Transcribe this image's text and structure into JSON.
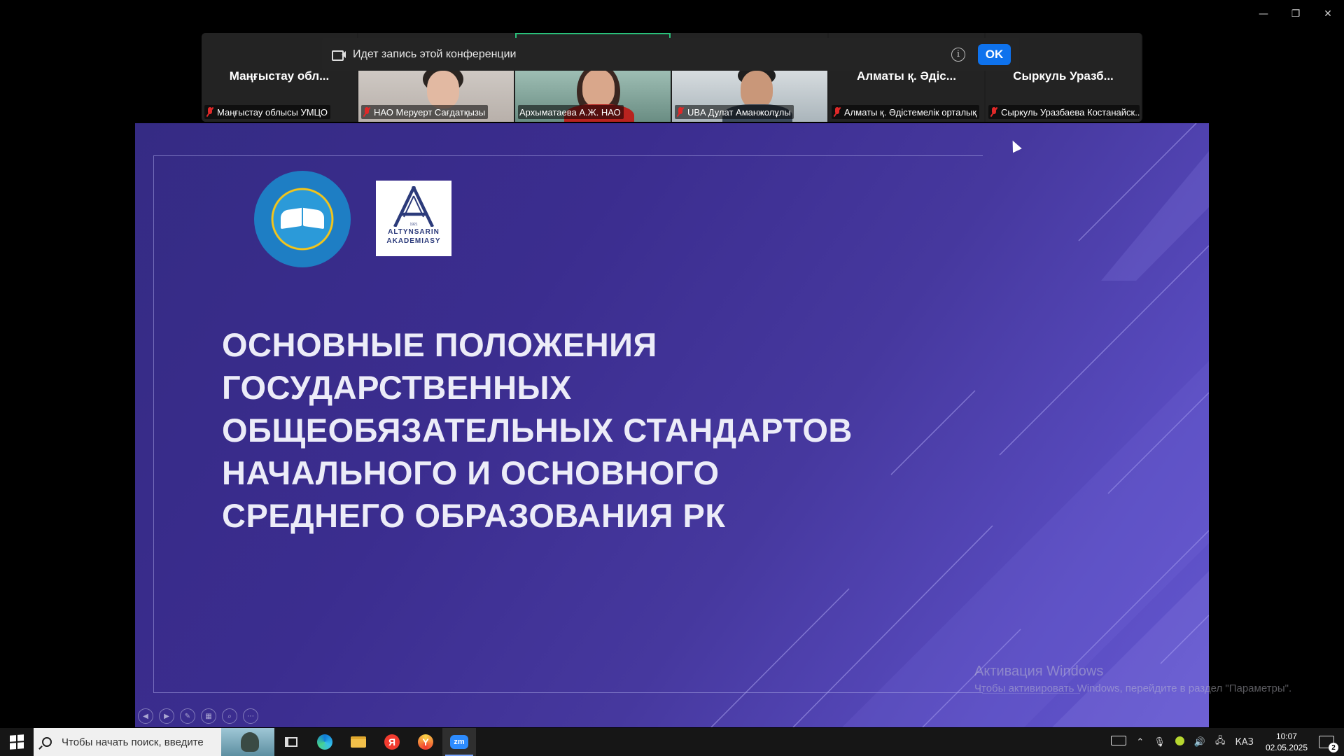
{
  "window": {
    "minimize": "—",
    "restore": "❐",
    "close": "✕"
  },
  "recording_banner": {
    "text": "Идет запись этой конференции",
    "info": "i",
    "ok_label": "OK"
  },
  "participants": [
    {
      "tile_name": "Маңғыстау обл...",
      "label": "Маңғыстау облысы УМЦО",
      "muted": true,
      "video": false
    },
    {
      "tile_name": "",
      "label": "НАО Меруерт Сағдатқызы",
      "muted": true,
      "video": true
    },
    {
      "tile_name": "",
      "label": "Архыматаева А.Ж. НАО",
      "muted": false,
      "video": true,
      "speaking": true
    },
    {
      "tile_name": "",
      "label": "UBA Дулат Аманжолұлы",
      "muted": true,
      "video": true
    },
    {
      "tile_name": "Алматы қ. Әдіс...",
      "label": "Алматы қ. Әдістемелік орталық",
      "muted": true,
      "video": false
    },
    {
      "tile_name": "Сыркуль Уразб...",
      "label": "Сыркуль Уразбаева Костанайск...",
      "muted": true,
      "video": false
    }
  ],
  "slide": {
    "logo_text_line1": "ALTYNSARIN",
    "logo_text_line2": "AKADEMIASY",
    "logo_year": "1921",
    "title_lines": [
      "ОСНОВНЫЕ ПОЛОЖЕНИЯ",
      "ГОСУДАРСТВЕННЫХ",
      "ОБЩЕОБЯЗАТЕЛЬНЫХ СТАНДАРТОВ",
      "НАЧАЛЬНОГО И ОСНОВНОГО",
      "СРЕДНЕГО ОБРАЗОВАНИЯ РК"
    ],
    "colors": {
      "background": "#3b2d8f",
      "accent": "#6457cf",
      "title": "#ececf8"
    }
  },
  "activation": {
    "line1": "Активация Windows",
    "line2": "Чтобы активировать Windows, перейдите в раздел \"Параметры\"."
  },
  "taskbar": {
    "search_placeholder": "Чтобы начать поиск, введите",
    "yandex_letter": "Я",
    "yandex_browser_letter": "Y",
    "zoom_label": "zm",
    "language": "КАЗ",
    "time": "10:07",
    "date": "02.05.2025",
    "notification_count": "2"
  }
}
